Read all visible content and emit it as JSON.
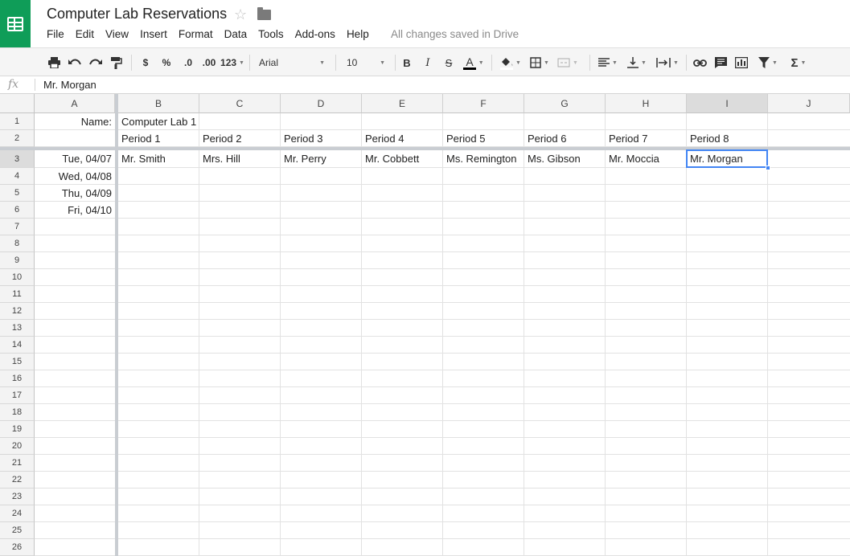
{
  "app": {
    "doc_title": "Computer Lab Reservations",
    "save_status": "All changes saved in Drive",
    "menus": [
      "File",
      "Edit",
      "View",
      "Insert",
      "Format",
      "Data",
      "Tools",
      "Add-ons",
      "Help"
    ]
  },
  "toolbar": {
    "currency": "$",
    "percent": "%",
    "decrease_decimals": ".0",
    "increase_decimals": ".00",
    "more_formats": "123",
    "font": "Arial",
    "font_size": "10",
    "bold": "B",
    "italic": "I",
    "strikethrough": "S",
    "text_color_letter": "A",
    "sum_symbol": "Σ",
    "icons": [
      "print-icon",
      "undo-icon",
      "redo-icon",
      "paint-format-icon",
      "fill-color-icon",
      "borders-icon",
      "merge-cells-icon",
      "align-left-icon",
      "valign-bottom-icon",
      "text-wrap-icon",
      "link-icon",
      "comment-icon",
      "chart-icon",
      "filter-icon",
      "sum-icon"
    ]
  },
  "formula_bar": {
    "fx": "fx",
    "value": "Mr. Morgan"
  },
  "sheet": {
    "columns": [
      "A",
      "B",
      "C",
      "D",
      "E",
      "F",
      "G",
      "H",
      "I",
      "J"
    ],
    "active_column": "I",
    "active_row": 3,
    "row_count": 26,
    "cells": {
      "A1": "Name:",
      "B1": "Computer Lab 1",
      "B2": "Period 1",
      "C2": "Period 2",
      "D2": "Period 3",
      "E2": "Period 4",
      "F2": "Period 5",
      "G2": "Period 6",
      "H2": "Period 7",
      "I2": "Period 8",
      "A3": "Tue, 04/07",
      "B3": "Mr. Smith",
      "C3": "Mrs. Hill",
      "D3": "Mr. Perry",
      "E3": "Mr. Cobbett",
      "F3": "Ms. Remington",
      "G3": "Ms. Gibson",
      "H3": "Mr. Moccia",
      "I3": "Mr. Morgan",
      "A4": "Wed, 04/08",
      "A5": "Thu, 04/09",
      "A6": "Fri, 04/10"
    },
    "right_aligned_columns": [
      "A"
    ]
  }
}
